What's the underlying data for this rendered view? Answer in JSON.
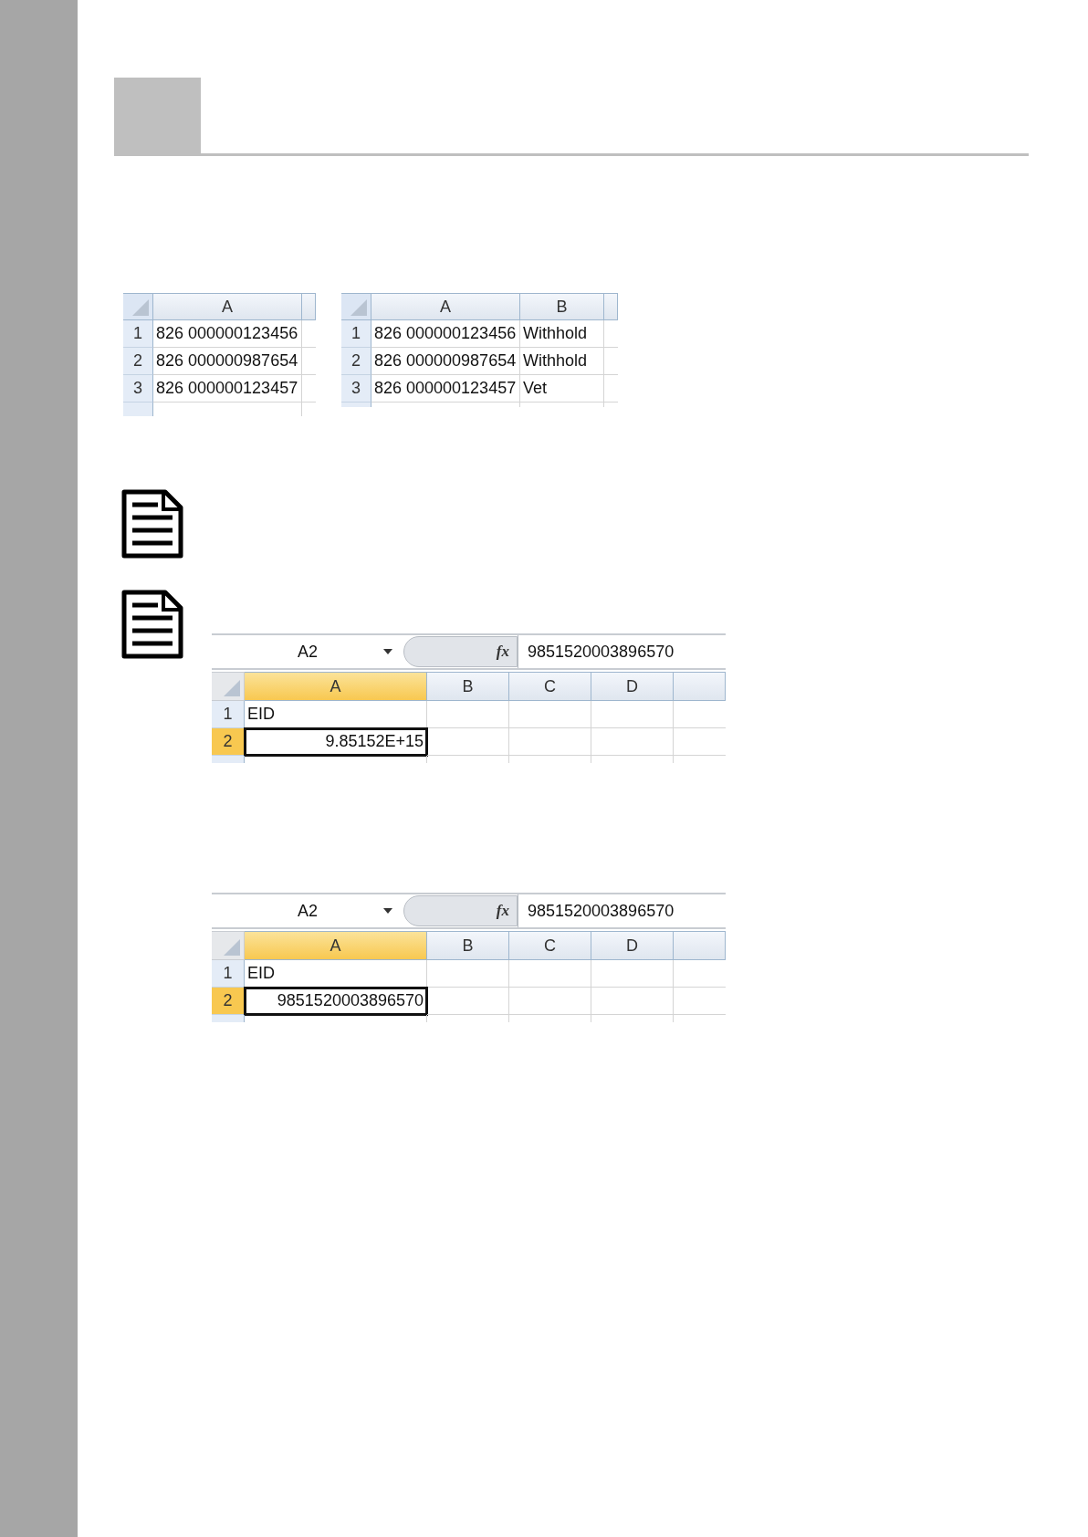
{
  "small_tables": [
    {
      "columns": [
        "A"
      ],
      "rows": [
        {
          "num": "1",
          "cells": [
            "826 000000123456"
          ]
        },
        {
          "num": "2",
          "cells": [
            "826 000000987654"
          ]
        },
        {
          "num": "3",
          "cells": [
            "826 000000123457"
          ]
        }
      ]
    },
    {
      "columns": [
        "A",
        "B"
      ],
      "rows": [
        {
          "num": "1",
          "cells": [
            "826 000000123456",
            "Withhold"
          ]
        },
        {
          "num": "2",
          "cells": [
            "826 000000987654",
            "Withhold"
          ]
        },
        {
          "num": "3",
          "cells": [
            "826 000000123457",
            "Vet"
          ]
        }
      ]
    }
  ],
  "excel_snippets": [
    {
      "name_box": "A2",
      "fx_label": "fx",
      "formula": "9851520003896570",
      "columns": [
        {
          "label": "A",
          "selected": true
        },
        {
          "label": "B",
          "selected": false
        },
        {
          "label": "C",
          "selected": false
        },
        {
          "label": "D",
          "selected": false
        }
      ],
      "rows": [
        {
          "num": "1",
          "selected": false,
          "cells": [
            {
              "kind": "text",
              "text": "EID",
              "selected": false
            }
          ]
        },
        {
          "num": "2",
          "selected": true,
          "cells": [
            {
              "kind": "number",
              "text": "9.85152E+15",
              "selected": true
            }
          ]
        }
      ]
    },
    {
      "name_box": "A2",
      "fx_label": "fx",
      "formula": "9851520003896570",
      "columns": [
        {
          "label": "A",
          "selected": true
        },
        {
          "label": "B",
          "selected": false
        },
        {
          "label": "C",
          "selected": false
        },
        {
          "label": "D",
          "selected": false
        }
      ],
      "rows": [
        {
          "num": "1",
          "selected": false,
          "cells": [
            {
              "kind": "text",
              "text": "EID",
              "selected": false
            }
          ]
        },
        {
          "num": "2",
          "selected": true,
          "cells": [
            {
              "kind": "number",
              "text": "9851520003896570",
              "selected": true
            }
          ]
        }
      ]
    }
  ]
}
